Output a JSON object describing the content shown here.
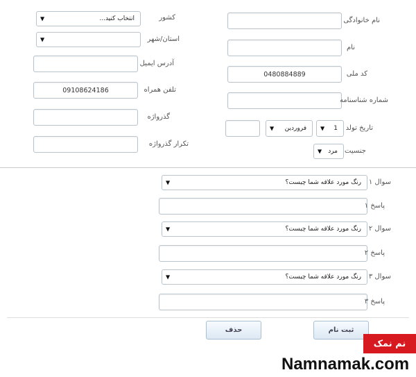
{
  "form": {
    "right": {
      "last_name_label": "نام خانوادگی",
      "first_name_label": "نام",
      "national_code_label": "کد ملی",
      "national_code_value": "0480884889",
      "id_number_label": "شماره شناسنامه",
      "birth_date_label": "تاریخ تولد",
      "birth_day_value": "1",
      "birth_month_value": "فروردین",
      "gender_label": "جنسیت",
      "gender_value": "مرد"
    },
    "left": {
      "country_label": "کشور",
      "country_value": "انتخاب کنید...",
      "province_label": "استان/شهر",
      "email_label": "آدرس ایمیل",
      "phone_label": "تلفن همراه",
      "phone_value": "09108624186",
      "password_label": "گذرواژه",
      "password_repeat_label": "تکرار گذرواژه"
    },
    "security": [
      {
        "question_label": "سوال ۱",
        "question_value": "رنگ مورد علاقه شما چیست؟",
        "answer_label": "پاسخ ۱"
      },
      {
        "question_label": "سوال ۲",
        "question_value": "رنگ مورد علاقه شما چیست؟",
        "answer_label": "پاسخ ۲"
      },
      {
        "question_label": "سوال ۳",
        "question_value": "رنگ مورد علاقه شما چیست؟",
        "answer_label": "پاسخ ۳"
      }
    ],
    "buttons": {
      "submit_label": "ثبت نام",
      "delete_label": "حذف"
    }
  },
  "branding": {
    "logo_text": "نم نمک",
    "site_name": "Namnamak.com"
  },
  "icons": {
    "dropdown": "caret-down-icon"
  }
}
